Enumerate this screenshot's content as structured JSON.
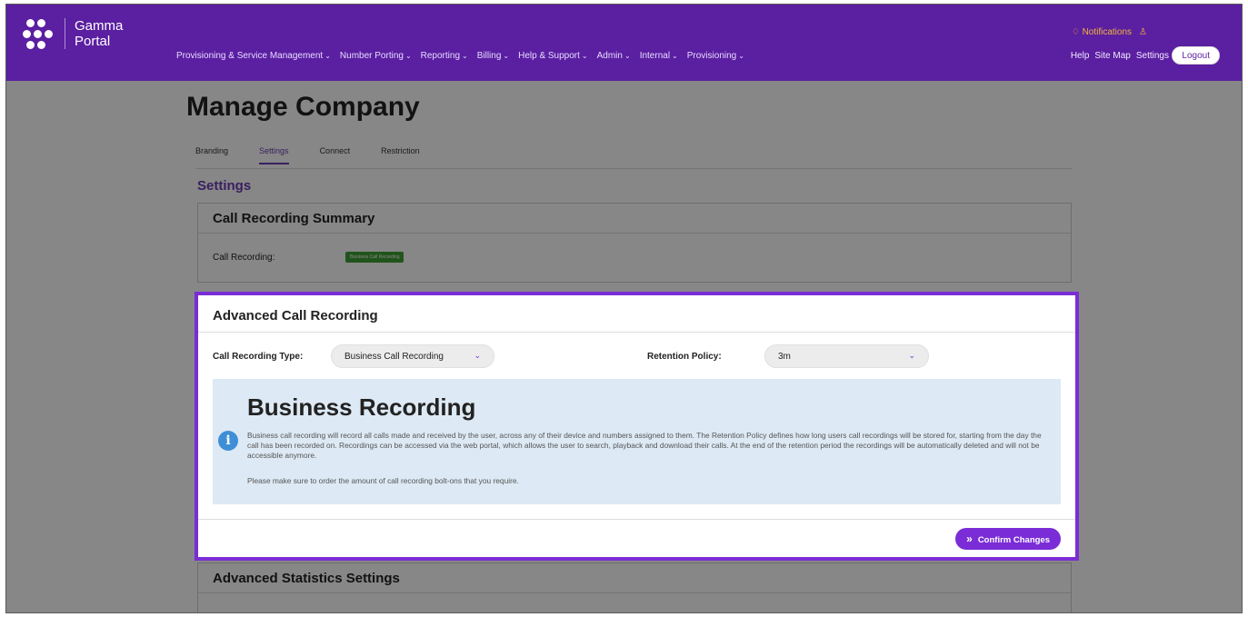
{
  "brand": {
    "line1": "Gamma",
    "line2": "Portal"
  },
  "nav": {
    "items": [
      "Provisioning & Service Management",
      "Number Porting",
      "Reporting",
      "Billing",
      "Help & Support",
      "Admin",
      "Internal",
      "Provisioning"
    ],
    "chevron": "⌄",
    "notifications": "Notifications",
    "right_links": [
      "Help",
      "Site Map",
      "Settings"
    ],
    "logout": "Logout"
  },
  "page": {
    "title": "Manage Company",
    "tabs": [
      "Branding",
      "Settings",
      "Connect",
      "Restriction"
    ],
    "active_tab": "Settings",
    "section": "Settings"
  },
  "summary": {
    "title": "Call Recording Summary",
    "label": "Call Recording:",
    "badge": "Business Call Recording"
  },
  "advanced": {
    "title": "Advanced Call Recording",
    "type_label": "Call Recording Type:",
    "type_value": "Business Call Recording",
    "retention_label": "Retention Policy:",
    "retention_value": "3m",
    "info_title": "Business Recording",
    "info_text": "Business call recording will record all calls made and received by the user, across any of their device and numbers assigned to them. The Retention Policy defines how long users call recordings will be stored for, starting from the day the call has been recorded on. Recordings can be accessed via the web portal, which allows the user to search, playback and download their calls. At the end of the retention period the recordings will be automatically deleted and will not be accessible anymore.",
    "info_note": "Please make sure to order the amount of call recording bolt-ons that you require.",
    "confirm": "Confirm Changes"
  },
  "stats": {
    "title": "Advanced Statistics Settings"
  },
  "colors": {
    "brand_purple": "#5b1fa1",
    "accent": "#7a2dd6",
    "badge_green": "#3f9f35",
    "info_bg": "#dde9f4"
  }
}
